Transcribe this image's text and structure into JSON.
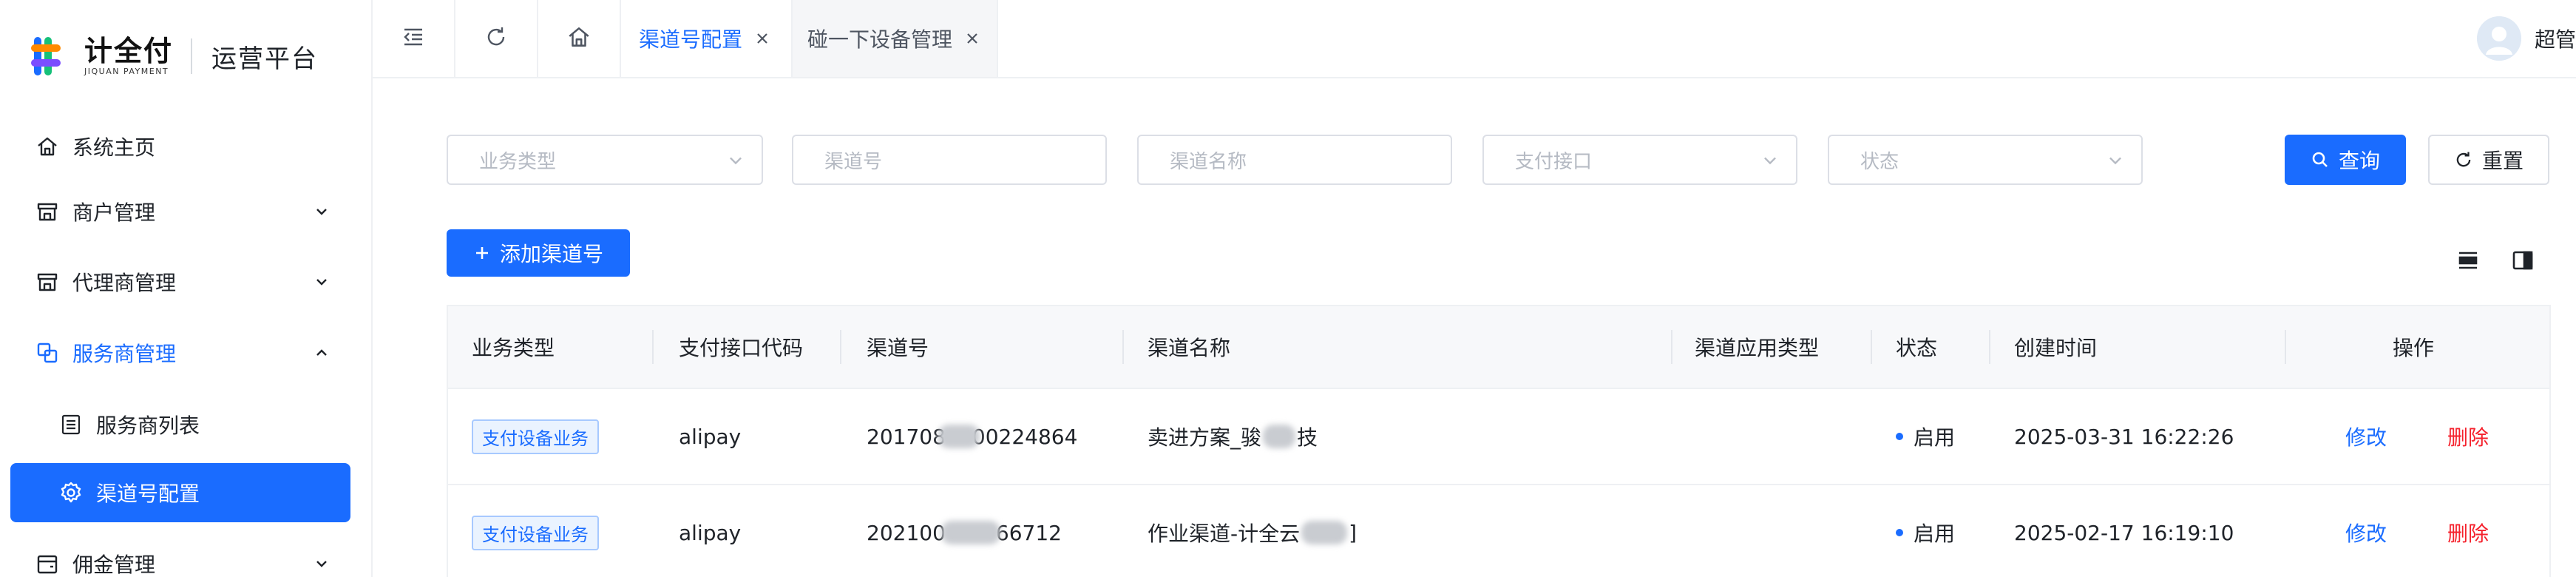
{
  "brand": {
    "name_cn": "计全付",
    "name_en": "JIQUAN PAYMENT",
    "platform": "运营平台",
    "colors": {
      "blue": "#1a6cff",
      "orange": "#ff8a00",
      "green": "#16c079",
      "purple": "#7b4dff"
    }
  },
  "sidebar": {
    "items": [
      {
        "label": "系统主页",
        "icon": "home-icon"
      },
      {
        "label": "商户管理",
        "icon": "store-icon",
        "arrow": "chevron-down"
      },
      {
        "label": "代理商管理",
        "icon": "store-icon",
        "arrow": "chevron-down"
      },
      {
        "label": "服务商管理",
        "icon": "layers-icon",
        "arrow": "chevron-up",
        "state": "open"
      },
      {
        "label": "服务商列表",
        "icon": "list-icon",
        "sub": true
      },
      {
        "label": "渠道号配置",
        "icon": "gear-icon",
        "sub": true,
        "state": "active"
      },
      {
        "label": "佣金管理",
        "icon": "wallet-icon",
        "arrow": "chevron-down"
      }
    ]
  },
  "topbar": {
    "tabs": [
      {
        "label": "渠道号配置",
        "active": true
      },
      {
        "label": "碰一下设备管理",
        "active": false
      }
    ],
    "user_name": "超管"
  },
  "filters": {
    "business_type": "业务类型",
    "channel_no": "渠道号",
    "channel_name": "渠道名称",
    "pay_interface": "支付接口",
    "status": "状态",
    "search_label": "查询",
    "reset_label": "重置",
    "add_label": "添加渠道号"
  },
  "table": {
    "columns": [
      "业务类型",
      "支付接口代码",
      "渠道号",
      "渠道名称",
      "渠道应用类型",
      "状态",
      "创建时间",
      "操作"
    ],
    "rows": [
      {
        "business_type": "支付设备业务",
        "interface_code": "alipay",
        "channel_no_prefix": "201708",
        "channel_no_suffix": "00224864",
        "channel_name_prefix": "卖进方案_骏",
        "channel_name_suffix": "技",
        "app_type": "",
        "status": "启用",
        "created_at": "2025-03-31 16:22:26",
        "edit": "修改",
        "delete": "删除"
      },
      {
        "business_type": "支付设备业务",
        "interface_code": "alipay",
        "channel_no_prefix": "202100",
        "channel_no_suffix": "66712",
        "channel_name_prefix": "作业渠道-计全云",
        "channel_name_suffix": "]",
        "app_type": "",
        "status": "启用",
        "created_at": "2025-02-17 16:19:10",
        "edit": "修改",
        "delete": "删除"
      }
    ]
  }
}
